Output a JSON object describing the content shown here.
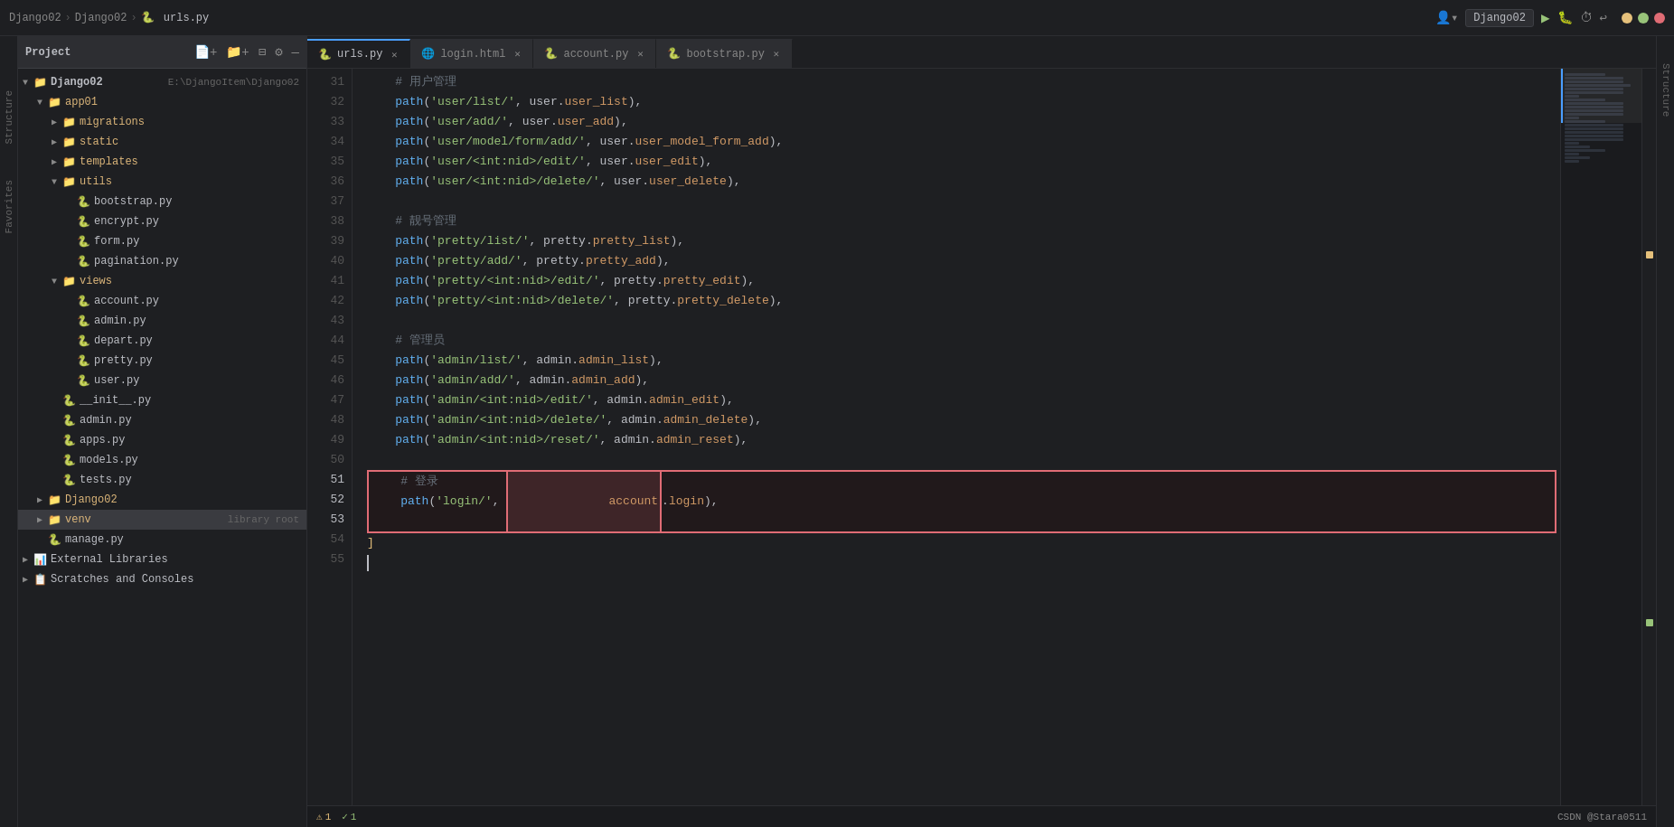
{
  "titlebar": {
    "breadcrumb": [
      "Django02",
      "Django02",
      "urls.py"
    ],
    "project_selector": "Django02",
    "right_icons": [
      "▶",
      "⚙",
      "▲"
    ]
  },
  "tabs": [
    {
      "id": "urls",
      "label": "urls.py",
      "icon": "🐍",
      "active": true
    },
    {
      "id": "login",
      "label": "login.html",
      "icon": "🌐",
      "active": false
    },
    {
      "id": "account",
      "label": "account.py",
      "icon": "🐍",
      "active": false
    },
    {
      "id": "bootstrap",
      "label": "bootstrap.py",
      "icon": "🐍",
      "active": false
    }
  ],
  "sidebar": {
    "header": "Project",
    "tree": [
      {
        "level": 0,
        "type": "project",
        "label": "Django02",
        "sublabel": "E:\\DjangoItem\\Django02",
        "expanded": true,
        "arrow": "▼"
      },
      {
        "level": 1,
        "type": "folder",
        "label": "app01",
        "expanded": true,
        "arrow": "▼"
      },
      {
        "level": 2,
        "type": "folder",
        "label": "migrations",
        "expanded": false,
        "arrow": "▶"
      },
      {
        "level": 2,
        "type": "folder",
        "label": "static",
        "expanded": false,
        "arrow": "▶"
      },
      {
        "level": 2,
        "type": "folder",
        "label": "templates",
        "expanded": false,
        "arrow": "▶"
      },
      {
        "level": 2,
        "type": "folder",
        "label": "utils",
        "expanded": true,
        "arrow": "▼"
      },
      {
        "level": 3,
        "type": "py",
        "label": "bootstrap.py"
      },
      {
        "level": 3,
        "type": "py",
        "label": "encrypt.py"
      },
      {
        "level": 3,
        "type": "py",
        "label": "form.py"
      },
      {
        "level": 3,
        "type": "py",
        "label": "pagination.py"
      },
      {
        "level": 2,
        "type": "folder",
        "label": "views",
        "expanded": true,
        "arrow": "▼"
      },
      {
        "level": 3,
        "type": "py",
        "label": "account.py"
      },
      {
        "level": 3,
        "type": "py",
        "label": "admin.py"
      },
      {
        "level": 3,
        "type": "py",
        "label": "depart.py"
      },
      {
        "level": 3,
        "type": "py",
        "label": "pretty.py"
      },
      {
        "level": 3,
        "type": "py",
        "label": "user.py"
      },
      {
        "level": 2,
        "type": "py",
        "label": "__init__.py"
      },
      {
        "level": 2,
        "type": "py",
        "label": "admin.py"
      },
      {
        "level": 2,
        "type": "py",
        "label": "apps.py"
      },
      {
        "level": 2,
        "type": "py",
        "label": "models.py"
      },
      {
        "level": 2,
        "type": "py",
        "label": "tests.py"
      },
      {
        "level": 1,
        "type": "folder",
        "label": "Django02",
        "expanded": false,
        "arrow": "▶"
      },
      {
        "level": 1,
        "type": "folder",
        "label": "venv",
        "sublabel": "library root",
        "expanded": false,
        "arrow": "▶"
      },
      {
        "level": 1,
        "type": "py",
        "label": "manage.py"
      },
      {
        "level": 0,
        "type": "group",
        "label": "External Libraries",
        "expanded": false,
        "arrow": "▶"
      },
      {
        "level": 0,
        "type": "group",
        "label": "Scratches and Consoles",
        "expanded": false,
        "arrow": "▶"
      }
    ]
  },
  "code": {
    "lines": [
      {
        "num": 31,
        "content": "    # 用户管理",
        "type": "comment"
      },
      {
        "num": 32,
        "content": "    path('user/list/', user.user_list),",
        "type": "code"
      },
      {
        "num": 33,
        "content": "    path('user/add/', user.user_add),",
        "type": "code"
      },
      {
        "num": 34,
        "content": "    path('user/model/form/add/', user.user_model_form_add),",
        "type": "code"
      },
      {
        "num": 35,
        "content": "    path('user/<int:nid>/edit/', user.user_edit),",
        "type": "code"
      },
      {
        "num": 36,
        "content": "    path('user/<int:nid>/delete/', user.user_delete),",
        "type": "code"
      },
      {
        "num": 37,
        "content": "",
        "type": "empty"
      },
      {
        "num": 38,
        "content": "    # 靓号管理",
        "type": "comment"
      },
      {
        "num": 39,
        "content": "    path('pretty/list/', pretty.pretty_list),",
        "type": "code"
      },
      {
        "num": 40,
        "content": "    path('pretty/add/', pretty.pretty_add),",
        "type": "code"
      },
      {
        "num": 41,
        "content": "    path('pretty/<int:nid>/edit/', pretty.pretty_edit),",
        "type": "code"
      },
      {
        "num": 42,
        "content": "    path('pretty/<int:nid>/delete/', pretty.pretty_delete),",
        "type": "code"
      },
      {
        "num": 43,
        "content": "",
        "type": "empty"
      },
      {
        "num": 44,
        "content": "    # 管理员",
        "type": "comment"
      },
      {
        "num": 45,
        "content": "    path('admin/list/', admin.admin_list),",
        "type": "code"
      },
      {
        "num": 46,
        "content": "    path('admin/add/', admin.admin_add),",
        "type": "code"
      },
      {
        "num": 47,
        "content": "    path('admin/<int:nid>/edit/', admin.admin_edit),",
        "type": "code"
      },
      {
        "num": 48,
        "content": "    path('admin/<int:nid>/delete/', admin.admin_delete),",
        "type": "code"
      },
      {
        "num": 49,
        "content": "    path('admin/<int:nid>/reset/', admin.admin_reset),",
        "type": "code"
      },
      {
        "num": 50,
        "content": "",
        "type": "empty"
      },
      {
        "num": 51,
        "content": "    # 登录",
        "type": "comment_highlight"
      },
      {
        "num": 52,
        "content": "    path('login/', account.login),",
        "type": "code_highlight"
      },
      {
        "num": 53,
        "content": "",
        "type": "empty_highlight"
      },
      {
        "num": 54,
        "content": "]",
        "type": "code"
      },
      {
        "num": 55,
        "content": "",
        "type": "cursor"
      }
    ]
  },
  "status": {
    "warnings": "1",
    "checks": "1",
    "bottom_text": "CSDN @Stara0511"
  },
  "left_tabs": [
    "Structure",
    "Favorites"
  ]
}
